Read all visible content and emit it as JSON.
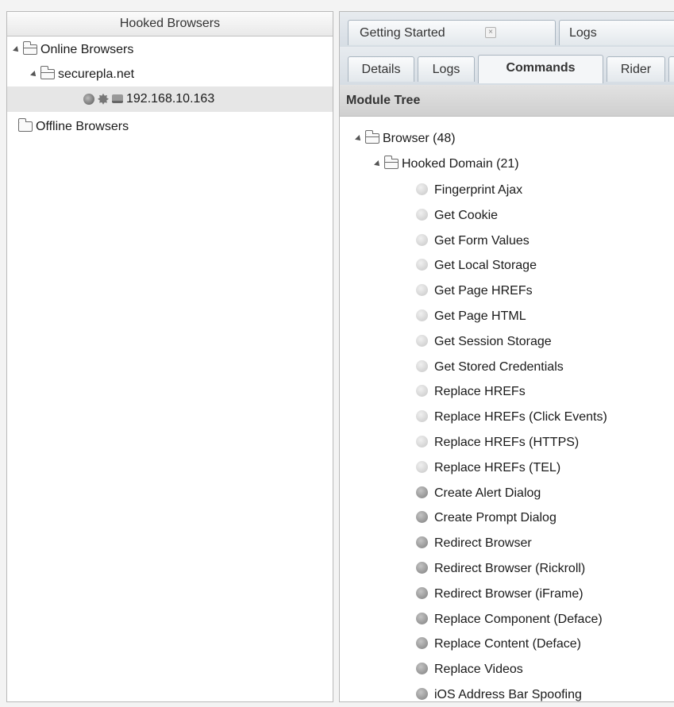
{
  "left_panel": {
    "title": "Hooked Browsers",
    "online_label": "Online Browsers",
    "domain_label": "securepla.net",
    "host_ip": "192.168.10.163",
    "offline_label": "Offline Browsers"
  },
  "tabs_top": [
    {
      "label": "Getting Started"
    },
    {
      "label": "Logs"
    }
  ],
  "tabs_sub": [
    {
      "label": "Details"
    },
    {
      "label": "Logs"
    },
    {
      "label": "Commands"
    },
    {
      "label": "Rider"
    }
  ],
  "module_tree": {
    "title": "Module Tree",
    "root": "Browser (48)",
    "group": "Hooked Domain (21)",
    "items": [
      {
        "label": "Fingerprint Ajax",
        "status": "light"
      },
      {
        "label": "Get Cookie",
        "status": "light"
      },
      {
        "label": "Get Form Values",
        "status": "light"
      },
      {
        "label": "Get Local Storage",
        "status": "light"
      },
      {
        "label": "Get Page HREFs",
        "status": "light"
      },
      {
        "label": "Get Page HTML",
        "status": "light"
      },
      {
        "label": "Get Session Storage",
        "status": "light"
      },
      {
        "label": "Get Stored Credentials",
        "status": "light"
      },
      {
        "label": "Replace HREFs",
        "status": "light"
      },
      {
        "label": "Replace HREFs (Click Events)",
        "status": "light"
      },
      {
        "label": "Replace HREFs (HTTPS)",
        "status": "light"
      },
      {
        "label": "Replace HREFs (TEL)",
        "status": "light"
      },
      {
        "label": "Create Alert Dialog",
        "status": "dark"
      },
      {
        "label": "Create Prompt Dialog",
        "status": "dark"
      },
      {
        "label": "Redirect Browser",
        "status": "dark"
      },
      {
        "label": "Redirect Browser (Rickroll)",
        "status": "dark"
      },
      {
        "label": "Redirect Browser (iFrame)",
        "status": "dark"
      },
      {
        "label": "Replace Component (Deface)",
        "status": "dark"
      },
      {
        "label": "Replace Content (Deface)",
        "status": "dark"
      },
      {
        "label": "Replace Videos",
        "status": "dark"
      },
      {
        "label": "iOS Address Bar Spoofing",
        "status": "dark"
      }
    ]
  },
  "colors": {
    "tab_bg": "#dde3e9",
    "selected_row": "#e6e6e6",
    "dot_light": "#d6d6d6",
    "dot_dark": "#8c8c8c"
  }
}
